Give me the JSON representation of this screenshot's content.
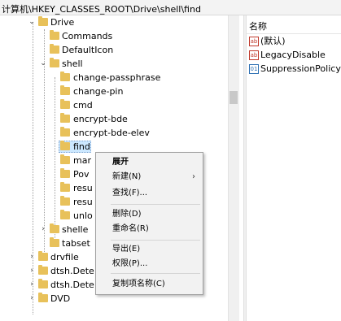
{
  "address_bar": {
    "path": "计算机\\HKEY_CLASSES_ROOT\\Drive\\shell\\find"
  },
  "tree": {
    "items": [
      {
        "label": "Drive",
        "expanded": true
      },
      {
        "label": "Commands"
      },
      {
        "label": "DefaultIcon"
      },
      {
        "label": "shell",
        "expanded": true
      },
      {
        "label": "change-passphrase"
      },
      {
        "label": "change-pin"
      },
      {
        "label": "cmd"
      },
      {
        "label": "encrypt-bde"
      },
      {
        "label": "encrypt-bde-elev"
      },
      {
        "label": "find",
        "selected": true
      },
      {
        "label": "mar"
      },
      {
        "label": "Pov"
      },
      {
        "label": "resu"
      },
      {
        "label": "resu"
      },
      {
        "label": "unlo"
      },
      {
        "label": "shelle"
      },
      {
        "label": "tabset"
      },
      {
        "label": "drvfile"
      },
      {
        "label": "dtsh.Dete"
      },
      {
        "label": "dtsh.Dete"
      },
      {
        "label": "DVD"
      }
    ]
  },
  "values_pane": {
    "header": "名称",
    "items": [
      {
        "label": "(默认)",
        "icon": "ab-icon"
      },
      {
        "label": "LegacyDisable",
        "icon": "ab-icon"
      },
      {
        "label": "SuppressionPolicy",
        "icon": "binary-value-icon"
      }
    ]
  },
  "context_menu": {
    "expand": "展开",
    "new": "新建(N)",
    "find": "查找(F)...",
    "delete": "删除(D)",
    "rename": "重命名(R)",
    "export": "导出(E)",
    "permissions": "权限(P)...",
    "copy_key_name": "复制项名称(C)",
    "submenu_arrow": "›"
  },
  "colors": {
    "folder": "#e8c15a",
    "selection": "#cce8ff",
    "menu_bg": "#f2f2f2"
  }
}
